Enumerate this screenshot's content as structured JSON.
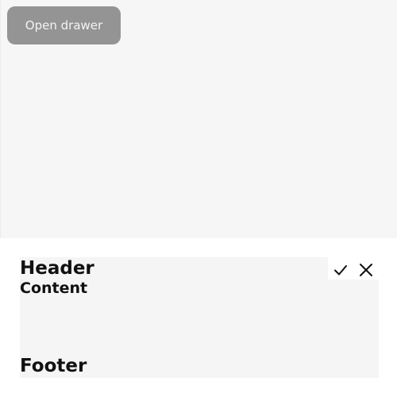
{
  "open_button": {
    "label": "Open drawer"
  },
  "drawer": {
    "header": "Header",
    "content": "Content",
    "footer": "Footer",
    "confirm_icon": "check-icon",
    "close_icon": "close-icon"
  },
  "colors": {
    "page_background": "#f6f6f6",
    "button_background": "#949494",
    "button_text": "#f4f4f4",
    "drawer_background": "#ffffff",
    "drawer_body_background": "#f5f5f5",
    "text": "#111111"
  }
}
